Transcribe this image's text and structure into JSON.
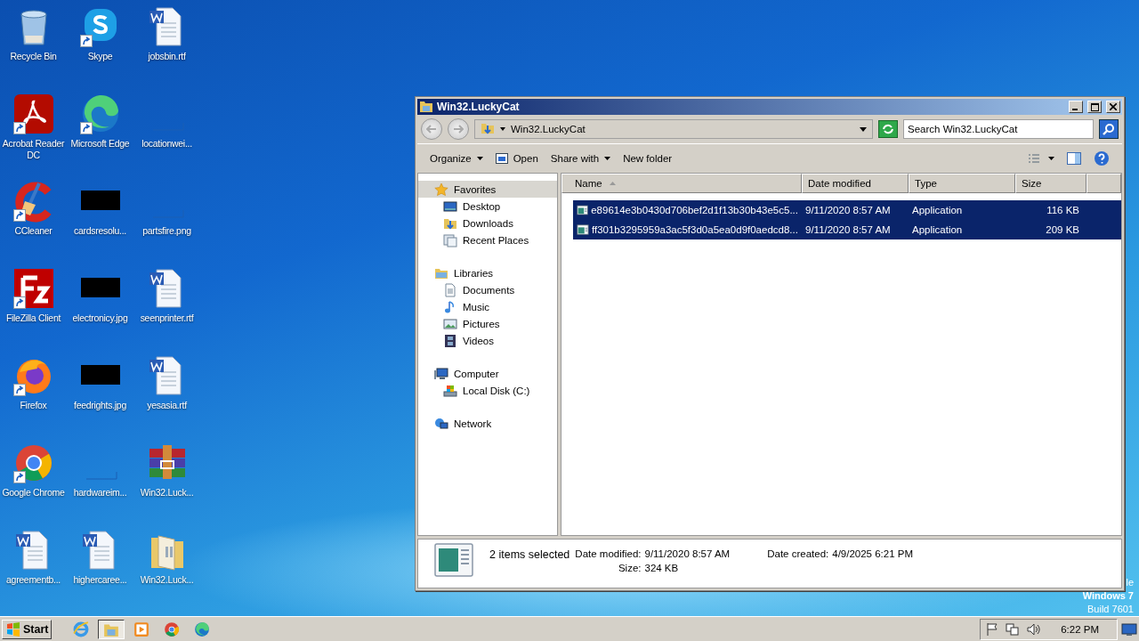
{
  "desktop": {
    "icons": [
      {
        "label": "Recycle Bin",
        "kind": "recycle",
        "shortcut": false
      },
      {
        "label": "Skype",
        "kind": "skype",
        "shortcut": true
      },
      {
        "label": "jobsbin.rtf",
        "kind": "word",
        "shortcut": false
      },
      {
        "label": "Acrobat Reader DC",
        "kind": "acrobat",
        "shortcut": true
      },
      {
        "label": "Microsoft Edge",
        "kind": "edge",
        "shortcut": true
      },
      {
        "label": "locationwei...",
        "kind": "blank",
        "shortcut": false
      },
      {
        "label": "CCleaner",
        "kind": "ccleaner",
        "shortcut": true
      },
      {
        "label": "cardsresolu...",
        "kind": "dark",
        "shortcut": false
      },
      {
        "label": "partsfire.png",
        "kind": "blank",
        "shortcut": false
      },
      {
        "label": "FileZilla Client",
        "kind": "filezilla",
        "shortcut": true
      },
      {
        "label": "electronicy.jpg",
        "kind": "dark",
        "shortcut": false
      },
      {
        "label": "seenprinter.rtf",
        "kind": "word",
        "shortcut": false
      },
      {
        "label": "Firefox",
        "kind": "firefox",
        "shortcut": true
      },
      {
        "label": "feedrights.jpg",
        "kind": "dark",
        "shortcut": false
      },
      {
        "label": "yesasia.rtf",
        "kind": "word",
        "shortcut": false
      },
      {
        "label": "Google Chrome",
        "kind": "chrome",
        "shortcut": true
      },
      {
        "label": "hardwareim...",
        "kind": "blank",
        "shortcut": false
      },
      {
        "label": "Win32.Luck...",
        "kind": "winrar",
        "shortcut": false
      },
      {
        "label": "agreementb...",
        "kind": "word",
        "shortcut": false
      },
      {
        "label": "highercaree...",
        "kind": "word",
        "shortcut": false
      },
      {
        "label": "Win32.Luck...",
        "kind": "folder",
        "shortcut": false
      }
    ],
    "os_text": [
      "le",
      "Windows 7",
      "Build 7601"
    ]
  },
  "window": {
    "title": "Win32.LuckyCat",
    "address": "Win32.LuckyCat",
    "search": {
      "placeholder": "Search Win32.LuckyCat"
    },
    "toolbar": [
      {
        "label": "Organize",
        "kind": "menu"
      },
      {
        "label": "Open",
        "kind": "open"
      },
      {
        "label": "Share with",
        "kind": "menu"
      },
      {
        "label": "New folder",
        "kind": "plain"
      }
    ],
    "sidebar": [
      {
        "label": "Favorites",
        "kind": "star",
        "selected": true,
        "children": [
          {
            "label": "Desktop",
            "kind": "desktop",
            "selected": false
          },
          {
            "label": "Downloads",
            "kind": "downloads",
            "selected": false
          },
          {
            "label": "Recent Places",
            "kind": "recent",
            "selected": false
          }
        ]
      },
      {
        "label": "Libraries",
        "kind": "libraries",
        "selected": false,
        "children": [
          {
            "label": "Documents",
            "kind": "documents",
            "selected": false
          },
          {
            "label": "Music",
            "kind": "music",
            "selected": false
          },
          {
            "label": "Pictures",
            "kind": "pictures",
            "selected": false
          },
          {
            "label": "Videos",
            "kind": "videos",
            "selected": false
          }
        ]
      },
      {
        "label": "Computer",
        "kind": "computer",
        "selected": false,
        "children": [
          {
            "label": "Local Disk (C:)",
            "kind": "disk",
            "selected": false
          }
        ]
      },
      {
        "label": "Network",
        "kind": "network",
        "selected": false
      }
    ],
    "table": {
      "columns": [
        {
          "label": "Name",
          "sorted": true
        },
        {
          "label": "Date modified",
          "sorted": false
        },
        {
          "label": "Type",
          "sorted": false
        },
        {
          "label": "Size",
          "sorted": false
        }
      ],
      "rows": [
        {
          "cells": [
            "e89614e3b0430d706bef2d1f13b30b43e5c5...",
            "9/11/2020 8:57 AM",
            "Application",
            "116 KB"
          ],
          "selected": true
        },
        {
          "cells": [
            "ff301b3295959a3ac5f3d0a5ea0d9f0aedcd8...",
            "9/11/2020 8:57 AM",
            "Application",
            "209 KB"
          ],
          "selected": true
        }
      ]
    },
    "details": {
      "summary": "2 items selected",
      "fields": [
        {
          "label": "Date modified:",
          "value": "9/11/2020 8:57 AM"
        },
        {
          "label": "Date created:",
          "value": "4/9/2025 6:21 PM"
        },
        {
          "label": "Size:",
          "value": "324 KB"
        }
      ]
    }
  },
  "taskbar": {
    "start": "Start",
    "apps": [
      {
        "kind": "ie",
        "selected": false
      },
      {
        "kind": "explorer",
        "selected": true
      },
      {
        "kind": "media",
        "selected": false
      },
      {
        "kind": "chrome",
        "selected": false
      },
      {
        "kind": "edge",
        "selected": false
      }
    ],
    "clock": "6:22 PM"
  }
}
